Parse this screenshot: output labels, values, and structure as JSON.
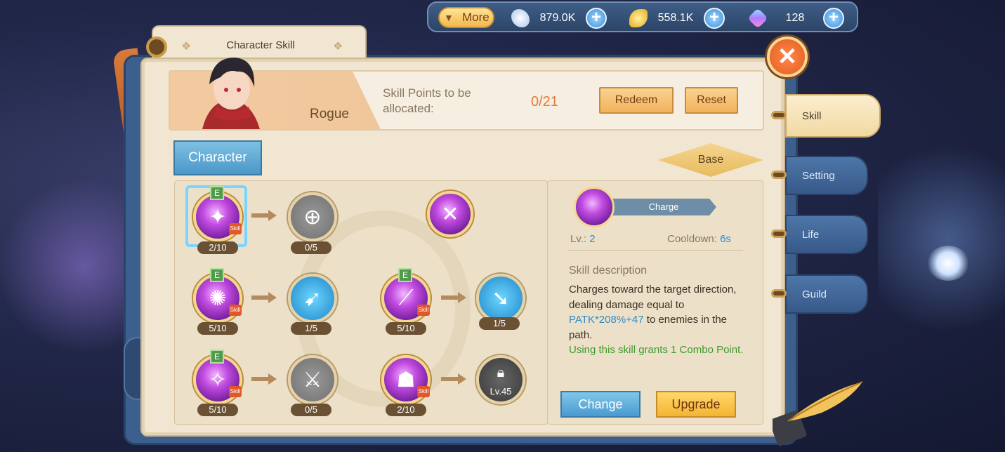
{
  "topbar": {
    "more_label": "More",
    "currencies": [
      {
        "icon": "crystal-icon",
        "value": "879.0K"
      },
      {
        "icon": "gold-leaf-icon",
        "value": "558.1K"
      },
      {
        "icon": "gem-icon",
        "value": "128"
      }
    ]
  },
  "window": {
    "title": "Character Skill"
  },
  "header": {
    "class_name": "Rogue",
    "skill_points_label": "Skill Points to be allocated:",
    "skill_points_value": "0/21",
    "redeem_label": "Redeem",
    "reset_label": "Reset"
  },
  "tabs": {
    "character": "Character",
    "base": "Base"
  },
  "skills": {
    "r1a": {
      "level": "2/10",
      "badge": "E",
      "tag": "Skill"
    },
    "r1b": {
      "level": "0/5"
    },
    "r2a": {
      "level": "5/10",
      "badge": "E",
      "tag": "Skill"
    },
    "r2b": {
      "level": "1/5"
    },
    "r2c": {
      "level": "5/10",
      "badge": "E",
      "tag": "Skill"
    },
    "r2d": {
      "level": "1/5"
    },
    "r3a": {
      "level": "5/10",
      "badge": "E",
      "tag": "Skill"
    },
    "r3b": {
      "level": "0/5"
    },
    "r3c": {
      "level": "2/10",
      "tag": "Skill"
    },
    "r3d": {
      "lock_text": "Lv.45"
    }
  },
  "detail": {
    "name": "Charge",
    "lv_label": "Lv.:",
    "lv_value": "2",
    "cooldown_label": "Cooldown:",
    "cooldown_value": "6s",
    "desc_title": "Skill description",
    "desc_part1": "Charges toward the target direction, dealing damage equal to ",
    "desc_highlight": "PATK*208%+47",
    "desc_part2": " to enemies in the path.",
    "desc_extra": "Using this skill grants 1 Combo Point.",
    "change_label": "Change",
    "upgrade_label": "Upgrade"
  },
  "side_tabs": [
    {
      "label": "Skill",
      "active": true
    },
    {
      "label": "Setting"
    },
    {
      "label": "Life"
    },
    {
      "label": "Guild"
    }
  ],
  "colors": {
    "accent_blue": "#2f8ec9",
    "accent_orange": "#e07b3a",
    "green_text": "#3f9b2a"
  }
}
